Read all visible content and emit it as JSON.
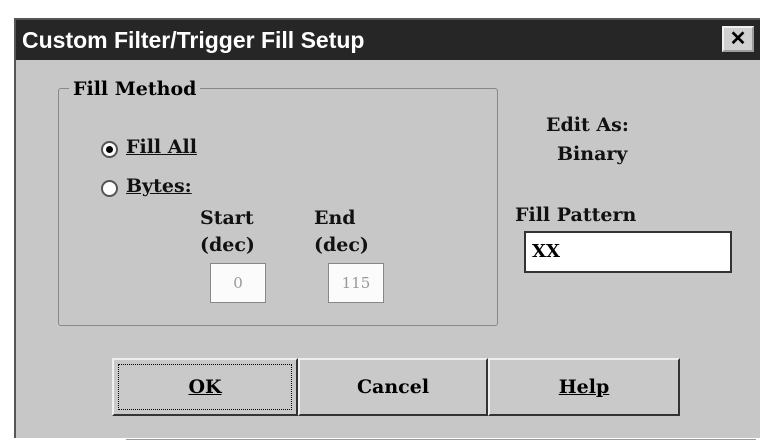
{
  "title": "Custom Filter/Trigger Fill Setup",
  "close_glyph": "✕",
  "fill_method": {
    "label": "Fill Method",
    "options": [
      {
        "label": "Fill All",
        "selected": true
      },
      {
        "label": "Bytes:",
        "selected": false
      }
    ],
    "start": {
      "label": "Start",
      "unit": "(dec)",
      "value": "0"
    },
    "end": {
      "label": "End",
      "unit": "(dec)",
      "value": "115"
    }
  },
  "edit_as": {
    "label": "Edit As:",
    "value": "Binary"
  },
  "fill_pattern": {
    "label": "Fill Pattern",
    "value": "XX"
  },
  "buttons": {
    "ok": "OK",
    "cancel": "Cancel",
    "help": "Help"
  }
}
